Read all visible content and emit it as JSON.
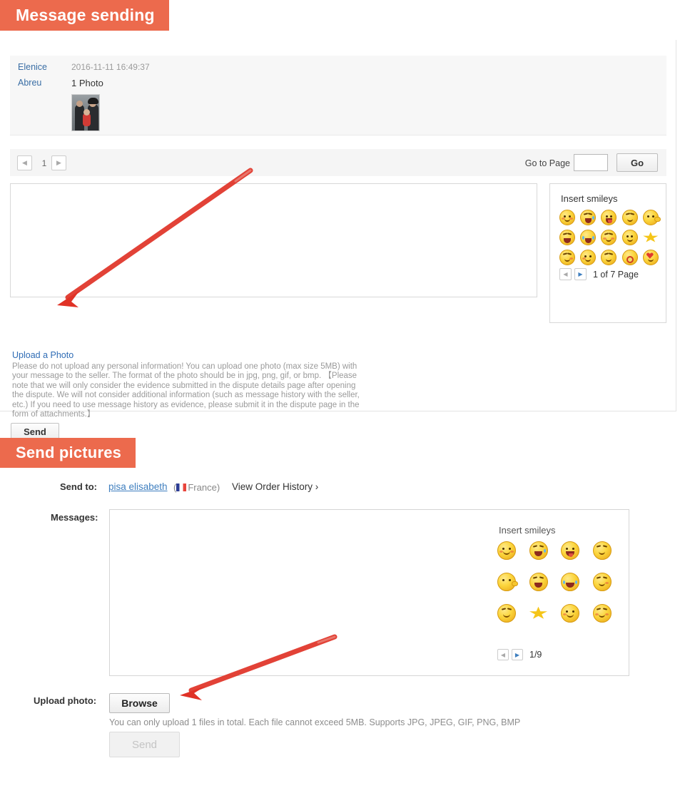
{
  "sections": {
    "message_sending": {
      "banner_title": "Message sending",
      "history": {
        "sender_line1": "Elenice",
        "sender_line2": "Abreu",
        "timestamp": "2016-11-11 16:49:37",
        "attachment_label": "1 Photo",
        "photo_alt": "family-photo-thumbnail"
      },
      "pager": {
        "prev_icon": "chevron-left-icon",
        "page_number": "1",
        "next_icon": "chevron-right-icon",
        "goto_label": "Go to Page",
        "goto_value": "",
        "goto_placeholder": "",
        "go_button": "Go"
      },
      "compose": {
        "value": "",
        "placeholder": ""
      },
      "smileys": {
        "title": "Insert smileys",
        "columns": 5,
        "rows": 3,
        "pager_text": "1 of 7 Page",
        "prev_icon": "chevron-left-icon",
        "next_icon": "chevron-right-icon",
        "items": [
          "smiley-neutral",
          "smiley-laugh-tears",
          "smiley-tongue-out",
          "smiley-facepalm",
          "smiley-shush",
          "smiley-laugh-open",
          "smiley-cry-laugh",
          "smiley-giggle",
          "smiley-pray",
          "smiley-star-dizzy",
          "smiley-sly",
          "smiley-smirk",
          "smiley-sleepy",
          "smiley-kiss-ring",
          "smiley-love-heart"
        ]
      },
      "upload": {
        "link_text": "Upload a Photo",
        "disclaimer": "Please do not upload any personal information! You can upload one photo (max size 5MB) with your message to the seller. The format of the photo should be in jpg, png, gif, or bmp. 【Please note that we will only consider the evidence submitted in the dispute details page after opening the dispute. We will not consider additional information (such as message history with the seller, etc.) If you need to use message history as evidence, please submit it in the dispute page in the form of attachments.】"
      },
      "send_button": "Send"
    },
    "send_pictures": {
      "banner_title": "Send pictures",
      "send_to": {
        "label": "Send to:",
        "name": "pisa elisabeth",
        "country": "France",
        "flag_icon": "flag-france-icon",
        "order_history_link": "View Order History",
        "order_history_chevron": "›"
      },
      "messages": {
        "label": "Messages:",
        "value": "",
        "placeholder": ""
      },
      "smileys": {
        "title": "Insert smileys",
        "columns": 4,
        "rows": 3,
        "pager_text": "1/9",
        "prev_icon": "chevron-left-icon",
        "next_icon": "chevron-right-icon",
        "items": [
          "smiley-neutral",
          "smiley-laugh-tears",
          "smiley-tongue-out",
          "smiley-facepalm",
          "smiley-shush",
          "smiley-laugh-open",
          "smiley-cry-laugh",
          "smiley-pray",
          "smiley-sleepy",
          "smiley-star-dizzy",
          "smiley-smirk",
          "smiley-giggle"
        ]
      },
      "upload": {
        "label": "Upload photo:",
        "browse_button": "Browse",
        "hint": "You can only upload 1 files in total. Each file cannot exceed 5MB. Supports JPG, JPEG, GIF, PNG, BMP"
      },
      "send_button": "Send"
    }
  },
  "annotations": {
    "arrow_1": {
      "name": "arrow-to-upload-a-photo",
      "color": "#e03226"
    },
    "arrow_2": {
      "name": "arrow-to-browse-button",
      "color": "#e03226"
    }
  },
  "colors": {
    "banner_orange": "#ec6a4d",
    "link_blue": "#3f7fbf",
    "muted_gray": "#9a9a9a",
    "annotation_red": "#e03226"
  }
}
